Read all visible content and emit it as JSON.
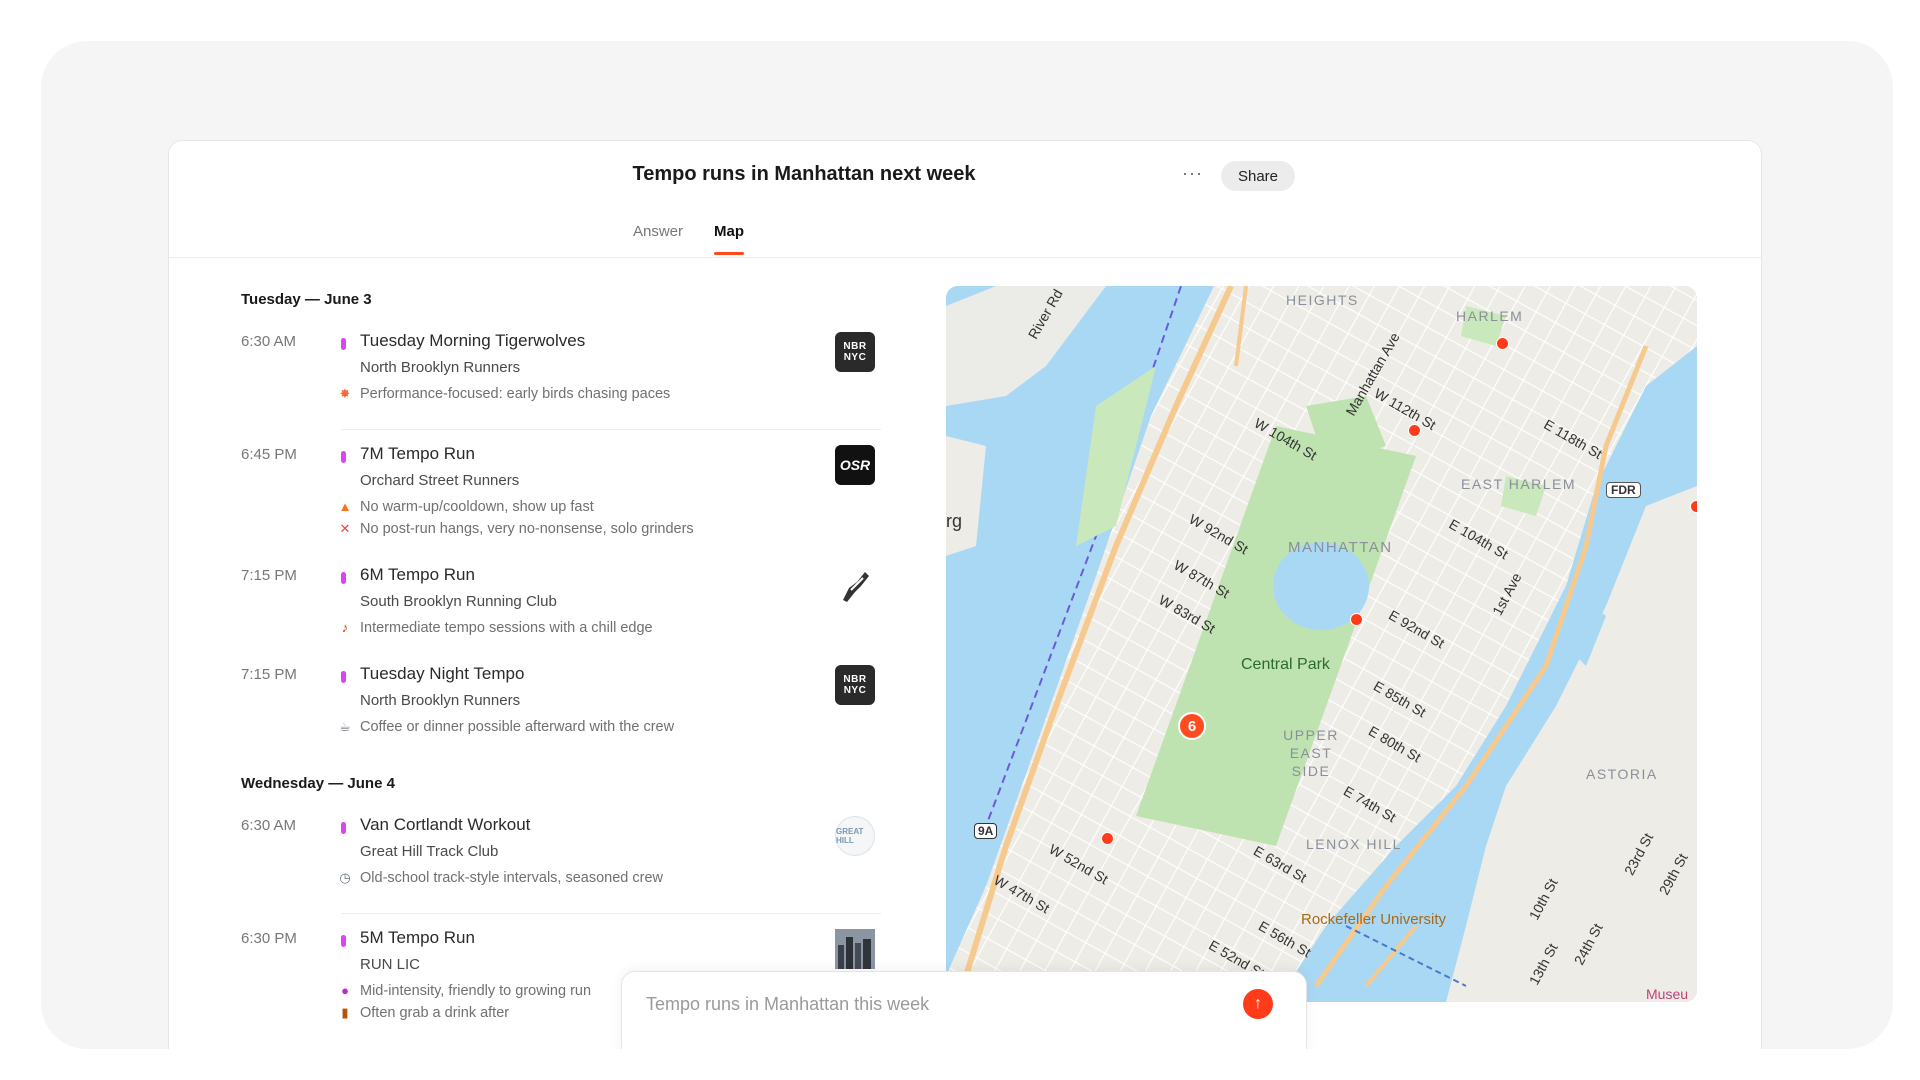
{
  "header": {
    "title": "Tempo runs in Manhattan next week",
    "more_label": "···",
    "share_label": "Share"
  },
  "tabs": [
    {
      "label": "Answer"
    },
    {
      "label": "Map"
    }
  ],
  "days": [
    {
      "label": "Tuesday — June 3",
      "events": [
        {
          "time": "6:30 AM",
          "name": "Tuesday Morning Tigerwolves",
          "club": "North Brooklyn Runners",
          "logo_text": "NBR NYC",
          "notes": [
            {
              "icon": "burst-icon",
              "text": "Performance-focused: early birds chasing paces"
            }
          ]
        },
        {
          "time": "6:45 PM",
          "name": "7M Tempo Run",
          "club": "Orchard Street Runners",
          "logo_text": "OSR",
          "notes": [
            {
              "icon": "fire-icon",
              "text": "No warm-up/cooldown, show up fast"
            },
            {
              "icon": "cross-icon",
              "text": "No post-run hangs, very no-nonsense, solo grinders"
            }
          ]
        },
        {
          "time": "7:15 PM",
          "name": "6M Tempo Run",
          "club": "South Brooklyn Running Club",
          "logo_text": "",
          "notes": [
            {
              "icon": "guitar-icon",
              "text": "Intermediate tempo sessions with a chill edge"
            }
          ]
        },
        {
          "time": "7:15 PM",
          "name": "Tuesday Night Tempo",
          "club": "North Brooklyn Runners",
          "logo_text": "NBR NYC",
          "notes": [
            {
              "icon": "coffee-icon",
              "text": "Coffee or dinner possible afterward with the crew"
            }
          ]
        }
      ]
    },
    {
      "label": "Wednesday — June 4",
      "events": [
        {
          "time": "6:30 AM",
          "name": "Van Cortlandt Workout",
          "club": "Great Hill Track Club",
          "logo_text": "GREAT HILL",
          "notes": [
            {
              "icon": "stopwatch-icon",
              "text": "Old-school track-style intervals, seasoned crew"
            }
          ]
        },
        {
          "time": "6:30 PM",
          "name": "5M Tempo Run",
          "club": "RUN LIC",
          "logo_text": "",
          "notes": [
            {
              "icon": "circle-icon",
              "text": "Mid-intensity, friendly to growing run"
            },
            {
              "icon": "beer-icon",
              "text": "Often grab a drink after"
            }
          ]
        }
      ]
    }
  ],
  "map": {
    "areas": [
      "HEIGHTS",
      "HARLEM",
      "EAST HARLEM",
      "MANHATTAN",
      "UPPER EAST SIDE",
      "LENOX HILL",
      "ASTORIA"
    ],
    "streets": [
      "River Rd",
      "Manhattan Ave",
      "W 112th St",
      "E 118th St",
      "W 104th St",
      "FDR",
      "W 92nd St",
      "E 104th St",
      "W 87th St",
      "W 83rd St",
      "E 92nd St",
      "1st Ave",
      "E 85th St",
      "E 80th St",
      "E 74th St",
      "W 52nd St",
      "W 47th St",
      "E 63rd St",
      "E 56th St",
      "E 52nd St",
      "10th St",
      "13th St",
      "24th St",
      "23rd St",
      "29th St",
      "9A",
      "rg"
    ],
    "places": [
      "Central Park",
      "Rockefeller University",
      "Museu"
    ],
    "cluster_count": "6"
  },
  "ask": {
    "placeholder": "Tempo runs in Manhattan this week",
    "send_icon": "arrow-up-icon"
  }
}
